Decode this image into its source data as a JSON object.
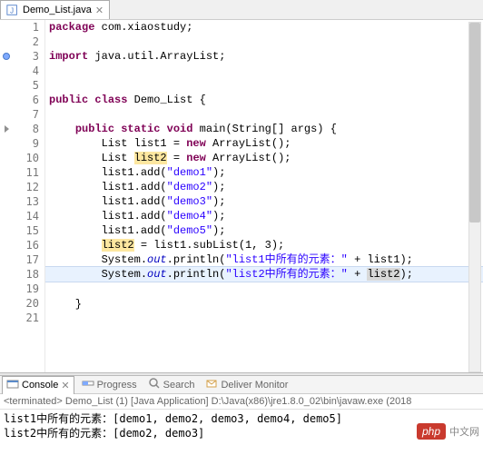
{
  "editor": {
    "tab": {
      "filename": "Demo_List.java"
    },
    "lines": {
      "1": {
        "num": "1",
        "tokens": [
          [
            "kw",
            "package"
          ],
          [
            "plain",
            " com.xiaostudy;"
          ]
        ]
      },
      "2": {
        "num": "2",
        "tokens": []
      },
      "3": {
        "num": "3",
        "marker": "circle",
        "tokens": [
          [
            "kw",
            "import"
          ],
          [
            "plain",
            " java.util.ArrayList;"
          ]
        ]
      },
      "4": {
        "num": "4",
        "tokens": []
      },
      "5": {
        "num": "5",
        "tokens": []
      },
      "6": {
        "num": "6",
        "tokens": [
          [
            "kw",
            "public"
          ],
          [
            "plain",
            " "
          ],
          [
            "kw",
            "class"
          ],
          [
            "plain",
            " Demo_List {"
          ]
        ]
      },
      "7": {
        "num": "7",
        "tokens": []
      },
      "8": {
        "num": "8",
        "marker": "triangle",
        "tokens": [
          [
            "plain",
            "    "
          ],
          [
            "kw",
            "public"
          ],
          [
            "plain",
            " "
          ],
          [
            "kw",
            "static"
          ],
          [
            "plain",
            " "
          ],
          [
            "kw",
            "void"
          ],
          [
            "plain",
            " main(String[] args) {"
          ]
        ]
      },
      "9": {
        "num": "9",
        "tokens": [
          [
            "plain",
            "        List list1 = "
          ],
          [
            "kw",
            "new"
          ],
          [
            "plain",
            " ArrayList();"
          ]
        ]
      },
      "10": {
        "num": "10",
        "tokens": [
          [
            "plain",
            "        List "
          ],
          [
            "hl",
            "list2"
          ],
          [
            "plain",
            " = "
          ],
          [
            "kw",
            "new"
          ],
          [
            "plain",
            " ArrayList();"
          ]
        ]
      },
      "11": {
        "num": "11",
        "tokens": [
          [
            "plain",
            "        list1.add("
          ],
          [
            "str",
            "\"demo1\""
          ],
          [
            "plain",
            ");"
          ]
        ]
      },
      "12": {
        "num": "12",
        "tokens": [
          [
            "plain",
            "        list1.add("
          ],
          [
            "str",
            "\"demo2\""
          ],
          [
            "plain",
            ");"
          ]
        ]
      },
      "13": {
        "num": "13",
        "tokens": [
          [
            "plain",
            "        list1.add("
          ],
          [
            "str",
            "\"demo3\""
          ],
          [
            "plain",
            ");"
          ]
        ]
      },
      "14": {
        "num": "14",
        "tokens": [
          [
            "plain",
            "        list1.add("
          ],
          [
            "str",
            "\"demo4\""
          ],
          [
            "plain",
            ");"
          ]
        ]
      },
      "15": {
        "num": "15",
        "tokens": [
          [
            "plain",
            "        list1.add("
          ],
          [
            "str",
            "\"demo5\""
          ],
          [
            "plain",
            ");"
          ]
        ]
      },
      "16": {
        "num": "16",
        "tokens": [
          [
            "plain",
            "        "
          ],
          [
            "hl",
            "list2"
          ],
          [
            "plain",
            " = list1.subList(1, 3);"
          ]
        ]
      },
      "17": {
        "num": "17",
        "tokens": [
          [
            "plain",
            "        System."
          ],
          [
            "static-ref",
            "out"
          ],
          [
            "plain",
            ".println("
          ],
          [
            "str",
            "\"list1中所有的元素："
          ],
          [
            "str",
            "\""
          ],
          [
            "plain",
            " + list1);"
          ]
        ]
      },
      "18": {
        "num": "18",
        "cursor": true,
        "tokens": [
          [
            "plain",
            "        System."
          ],
          [
            "static-ref",
            "out"
          ],
          [
            "plain",
            ".println("
          ],
          [
            "str",
            "\"list2中所有的元素："
          ],
          [
            "str",
            "\""
          ],
          [
            "plain",
            " + "
          ],
          [
            "hl-gray",
            "list2"
          ],
          [
            "plain",
            ");"
          ]
        ]
      },
      "19": {
        "num": "19",
        "tokens": []
      },
      "20": {
        "num": "20",
        "tokens": [
          [
            "plain",
            "    }"
          ]
        ]
      },
      "21": {
        "num": "21",
        "tokens": []
      }
    }
  },
  "console": {
    "tabs": {
      "console": "Console",
      "progress": "Progress",
      "search": "Search",
      "deliver": "Deliver Monitor"
    },
    "header": "<terminated> Demo_List (1) [Java Application] D:\\Java(x86)\\jre1.8.0_02\\bin\\javaw.exe (2018",
    "out1": "list1中所有的元素：[demo1, demo2, demo3, demo4, demo5]",
    "out2": "list2中所有的元素：[demo2, demo3]"
  },
  "watermark": {
    "badge": "php",
    "text": "中文网"
  }
}
